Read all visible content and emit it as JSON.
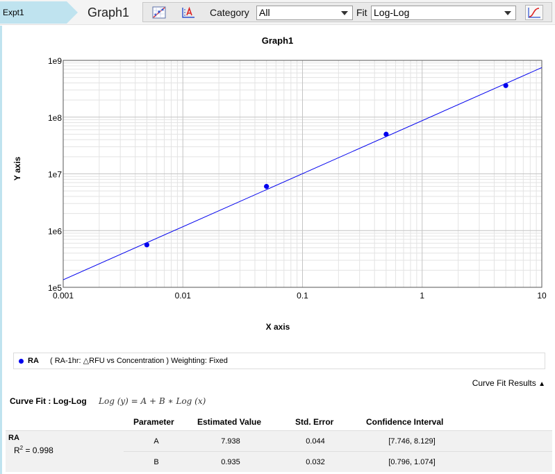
{
  "toolbar": {
    "breadcrumb": "Expt1",
    "graph_title": "Graph1",
    "category_label": "Category",
    "category_value": "All",
    "fit_label": "Fit",
    "fit_value": "Log-Log"
  },
  "chart_data": {
    "type": "scatter",
    "title": "Graph1",
    "xlabel": "X axis",
    "ylabel": "Y axis",
    "x_scale": "log",
    "y_scale": "log",
    "xlim": [
      0.001,
      10
    ],
    "ylim": [
      100000,
      1000000000
    ],
    "x_ticks": [
      "0.001",
      "0.01",
      "0.1",
      "1",
      "10"
    ],
    "y_ticks": [
      "1e5",
      "1e6",
      "1e7",
      "1e8",
      "1e9"
    ],
    "grid": true,
    "series": [
      {
        "name": "RA",
        "color": "#0000ee",
        "points": [
          {
            "x": 0.005,
            "y": 560000
          },
          {
            "x": 0.05,
            "y": 6000000
          },
          {
            "x": 0.5,
            "y": 50000000
          },
          {
            "x": 5,
            "y": 360000000
          }
        ],
        "fit": {
          "model": "Log-Log",
          "A": 7.938,
          "B": 0.935
        }
      }
    ]
  },
  "legend": {
    "series_name": "RA",
    "description": "( RA-1hr: △RFU vs Concentration )  Weighting: Fixed"
  },
  "results": {
    "toggle_label": "Curve Fit Results",
    "toggle_icon": "triangle-up-icon",
    "fit_label": "Curve Fit : Log-Log",
    "equation": "Log (y) = A + B ∗ Log (x)",
    "columns": [
      "Parameter",
      "Estimated Value",
      "Std. Error",
      "Confidence Interval"
    ],
    "series_name": "RA",
    "r2_label": "R",
    "r2_sup": "2",
    "r2_value": " = 0.998",
    "rows": [
      {
        "param": "A",
        "estimate": "7.938",
        "stderr": "0.044",
        "ci": "[7.746, 8.129]"
      },
      {
        "param": "B",
        "estimate": "0.935",
        "stderr": "0.032",
        "ci": "[0.796, 1.074]"
      }
    ]
  }
}
